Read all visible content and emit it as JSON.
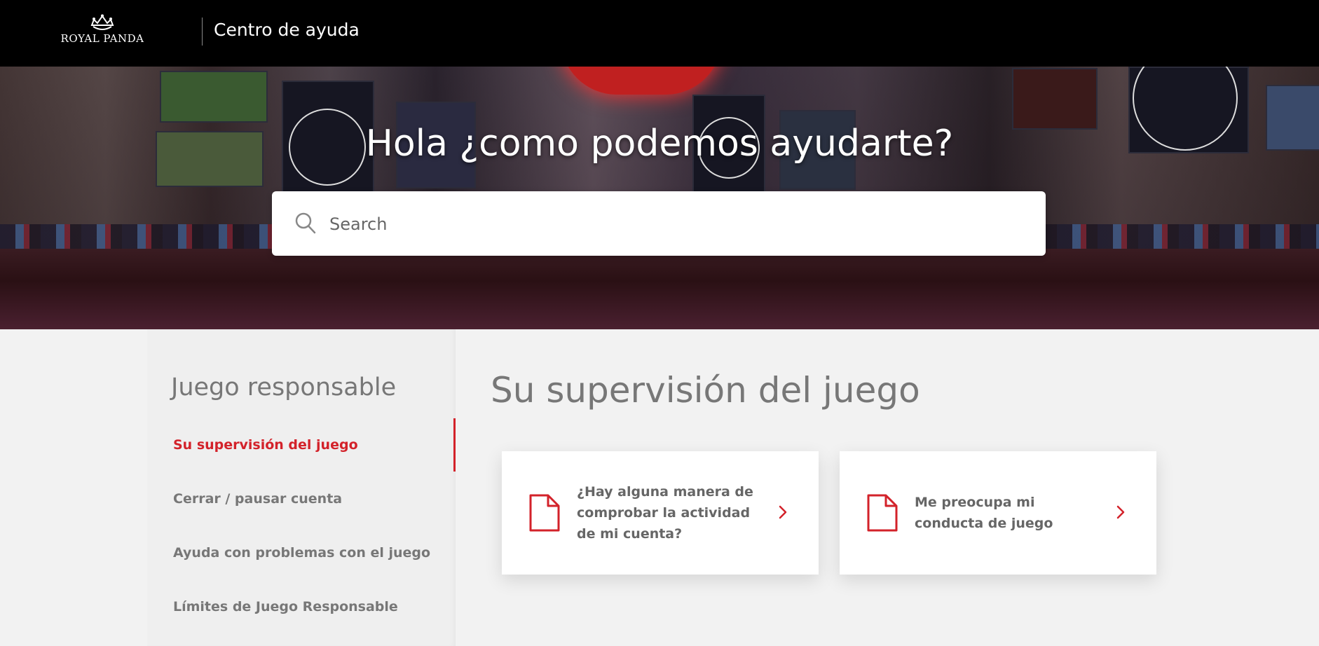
{
  "header": {
    "logo_text": "ROYAL PANDA",
    "site_title": "Centro de ayuda"
  },
  "hero": {
    "title": "Hola ¿como podemos ayudarte?",
    "search_placeholder": "Search"
  },
  "sidebar": {
    "title": "Juego responsable",
    "items": [
      {
        "label": "Su supervisión del juego",
        "active": true
      },
      {
        "label": "Cerrar / pausar cuenta",
        "active": false
      },
      {
        "label": "Ayuda con problemas con el juego",
        "active": false
      },
      {
        "label": "Límites de Juego Responsable",
        "active": false
      }
    ]
  },
  "main": {
    "section_title": "Su supervisión del juego",
    "articles": [
      {
        "title": "¿Hay alguna manera de comprobar la actividad de mi cuenta?"
      },
      {
        "title": "Me preocupa mi conducta de juego"
      }
    ]
  },
  "colors": {
    "accent": "#d3222a",
    "header_bg": "#000000",
    "page_bg": "#f2f2f2"
  },
  "icons": [
    "crown-icon",
    "search-icon",
    "document-icon",
    "chevron-right-icon"
  ]
}
